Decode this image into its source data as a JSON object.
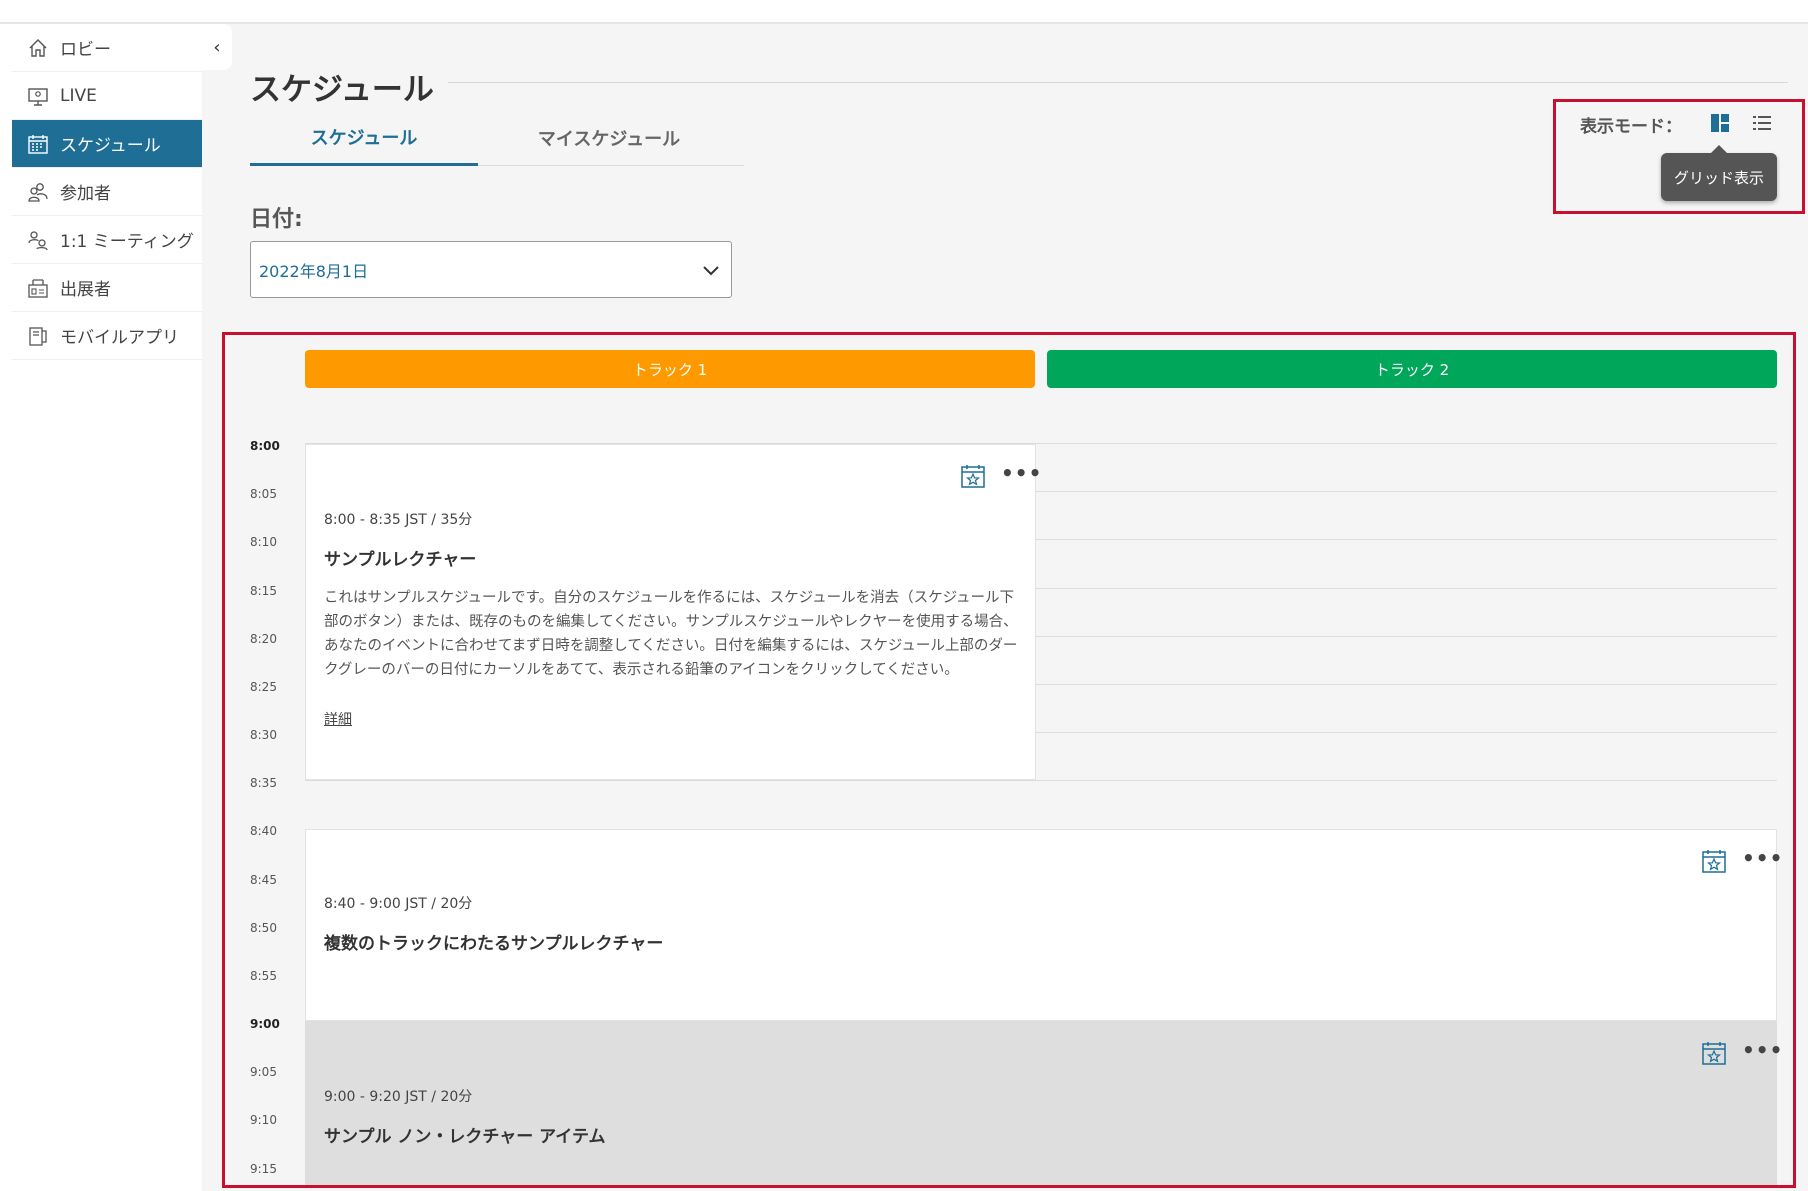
{
  "sidebar": {
    "items": [
      {
        "label": "ロビー",
        "icon": "home-icon"
      },
      {
        "label": "LIVE",
        "icon": "monitor-icon"
      },
      {
        "label": "スケジュール",
        "icon": "calendar-icon",
        "active": true
      },
      {
        "label": "参加者",
        "icon": "people-icon"
      },
      {
        "label": "1:1 ミーティング",
        "icon": "meeting-icon"
      },
      {
        "label": "出展者",
        "icon": "booth-icon"
      },
      {
        "label": "モバイルアプリ",
        "icon": "mobile-icon"
      }
    ],
    "collapse_glyph": "‹"
  },
  "page": {
    "title": "スケジュール",
    "tabs": [
      "スケジュール",
      "マイスケジュール"
    ],
    "date_label": "日付:",
    "date_value": "2022年8月1日"
  },
  "view_mode": {
    "label": "表示モード：",
    "tooltip": "グリッド表示",
    "selected": "grid"
  },
  "grid": {
    "tracks": [
      {
        "label": "トラック 1",
        "color": "#ff9900"
      },
      {
        "label": "トラック 2",
        "color": "#00a65a"
      }
    ],
    "times": [
      "8:00",
      "8:05",
      "8:10",
      "8:15",
      "8:20",
      "8:25",
      "8:30",
      "8:35",
      "8:40",
      "8:45",
      "8:50",
      "8:55",
      "9:00",
      "9:05",
      "9:10",
      "9:15"
    ],
    "sessions": [
      {
        "time": "8:00 - 8:35 JST / 35分",
        "title": "サンプルレクチャー",
        "description_lines": [
          "これはサンプルスケジュールです。自分のスケジュールを作るには、スケジュールを消去（スケジュール下",
          "部のボタン）または、既存のものを編集してください。サンプルスケジュールやレクヤーを使用する場合、",
          "あなたのイベントに合わせてまず日時を調整してください。日付を編集するには、スケジュール上部のダー",
          "クグレーのバーの日付にカーソルをあてて、表示される鉛筆のアイコンをクリックしてください。"
        ],
        "link": "詳細"
      },
      {
        "time": "8:40 - 9:00 JST / 20分",
        "title": "複数のトラックにわたるサンプルレクチャー"
      },
      {
        "time": "9:00 - 9:20 JST / 20分",
        "title": "サンプル ノン・レクチャー アイテム"
      }
    ],
    "more_glyph": "•••"
  },
  "colors": {
    "accent": "#1e6e96",
    "highlight": "#c8102e"
  }
}
